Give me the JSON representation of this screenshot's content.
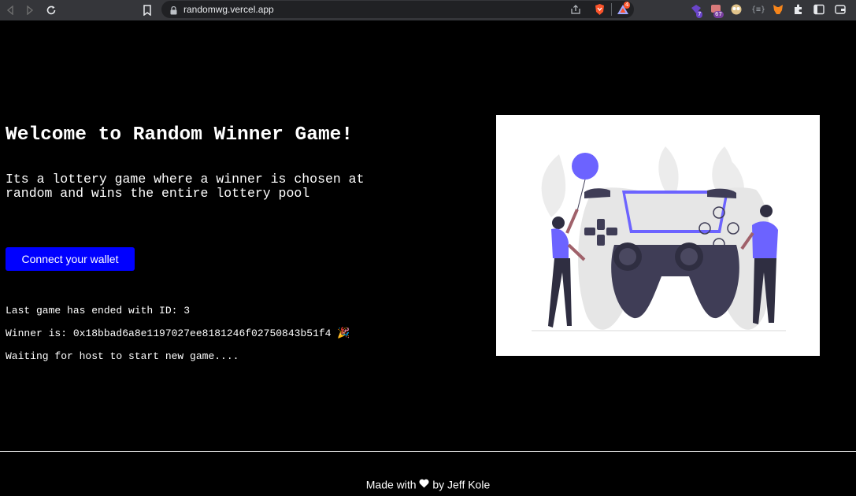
{
  "browser": {
    "url": "randomwg.vercel.app",
    "extension_badges": [
      "4",
      "7",
      "67"
    ],
    "icons": [
      "back-icon",
      "forward-icon",
      "reload-icon",
      "bookmark-icon",
      "lock-icon",
      "share-icon",
      "brave-shield-icon",
      "brave-rewards-icon",
      "extensions-icon",
      "sidebar-icon",
      "wallet-icon"
    ]
  },
  "page": {
    "title": "Welcome to Random Winner Game!",
    "description": "Its a lottery game where a winner is chosen at random and wins the entire lottery pool",
    "connect_button": "Connect your wallet",
    "last_game": "Last game has ended with ID: 3",
    "winner": "Winner is: 0x18bbad6a8e1197027ee8181246f02750843b51f4 🎉",
    "waiting": "Waiting for host to start new game...."
  },
  "footer": {
    "made_with": "Made with",
    "by": "by Jeff Kole"
  },
  "colors": {
    "button": "#0000ff",
    "accent": "#6c63ff",
    "background": "#000000"
  }
}
